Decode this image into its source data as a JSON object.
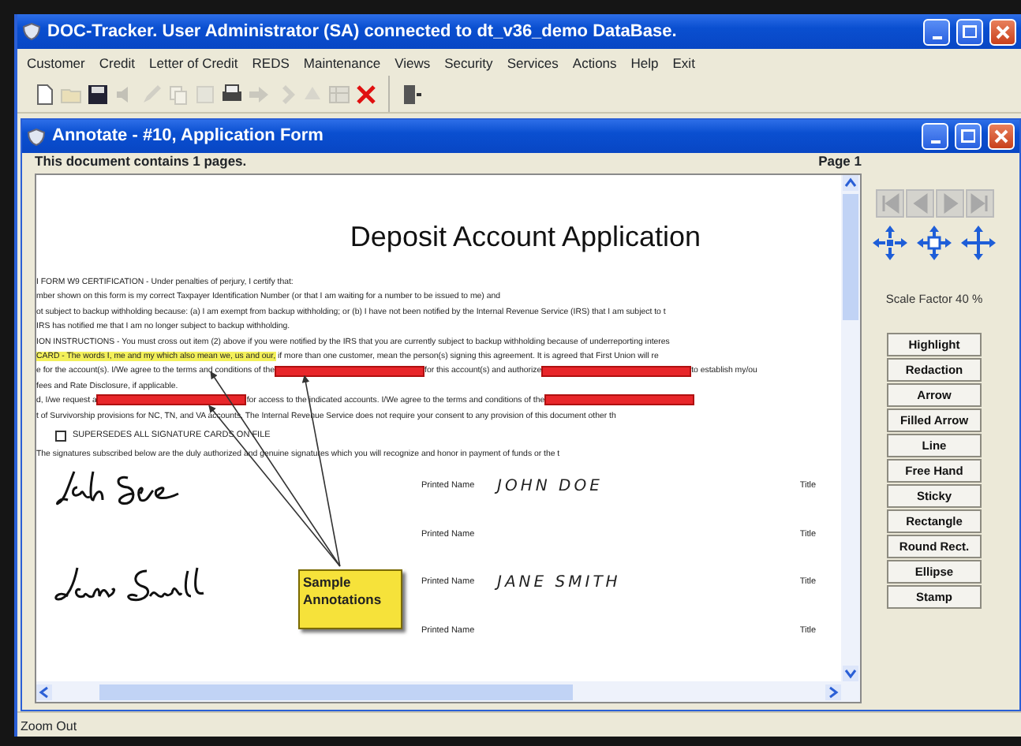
{
  "window": {
    "title": "DOC-Tracker. User Administrator (SA) connected to dt_v36_demo DataBase."
  },
  "menu": [
    "Customer",
    "Credit",
    "Letter of Credit",
    "REDS",
    "Maintenance",
    "Views",
    "Security",
    "Services",
    "Actions",
    "Help",
    "Exit"
  ],
  "toolbar": [
    {
      "disabled": false
    },
    {
      "disabled": true
    },
    {
      "disabled": false
    },
    {
      "disabled": true
    },
    {
      "disabled": true
    },
    {
      "disabled": true
    },
    {
      "disabled": true
    },
    {
      "disabled": false
    },
    {
      "disabled": true
    },
    {
      "disabled": true
    },
    {
      "disabled": true
    },
    {
      "disabled": true
    },
    {
      "disabled": false
    },
    {
      "disabled": false
    }
  ],
  "child_window": {
    "title": "Annotate - #10, Application Form",
    "info": "This document contains 1 pages.",
    "page": "Page 1"
  },
  "document": {
    "title": "Deposit Account Application",
    "lines": [
      [
        {
          "kind": "text",
          "text": "I FORM W9 CERTIFICATION - Under penalties of perjury, I certify that:"
        }
      ],
      [
        {
          "kind": "text",
          "text": "mber shown on this form is my correct Taxpayer Identification Number (or that I am waiting for a number to be issued to me) and"
        }
      ],
      [
        {
          "kind": "text",
          "text": "ot subject to backup withholding because: (a) I am exempt from backup withholding; or (b) I have not been notified by the Internal Revenue Service (IRS) that I am subject to t"
        }
      ],
      [
        {
          "kind": "text",
          "text": "IRS has notified me that I am no longer subject to backup withholding."
        }
      ],
      [
        {
          "kind": "text",
          "text": "ION INSTRUCTIONS - You must cross out item (2) above if you were notified by the IRS that you are currently subject to backup withholding because of underreporting interes"
        }
      ],
      [
        {
          "kind": "highlight",
          "text": "CARD - The words I, me and my which also mean we, us and our,"
        },
        {
          "kind": "text",
          "text": " if more than one customer, mean the person(s) signing this agreement.  It is agreed that First Union will re"
        }
      ],
      [
        {
          "kind": "text",
          "text": "e for the account(s).  I/We agree to the terms and conditions of the"
        },
        {
          "kind": "redaction"
        },
        {
          "kind": "text",
          "text": "for this account(s) and authorize"
        },
        {
          "kind": "redaction"
        },
        {
          "kind": "text",
          "text": "to establish my/ou"
        }
      ],
      [
        {
          "kind": "text",
          "text": "fees and Rate Disclosure, if applicable."
        }
      ],
      [
        {
          "kind": "text",
          "text": "d, I/we request a"
        },
        {
          "kind": "redaction"
        },
        {
          "kind": "text",
          "text": "for access to the indicated accounts. I/We agree to the terms and conditions of the"
        },
        {
          "kind": "redaction"
        }
      ],
      [
        {
          "kind": "text",
          "text": "t of Survivorship provisions for NC, TN, and VA accounts.  The Internal Revenue Service does not require your consent to any provision of this document other th"
        }
      ]
    ],
    "checkbox": {
      "label": "SUPERSEDES ALL SIGNATURE CARDS ON FILE",
      "checked": false
    },
    "statement": "The signatures subscribed below are the duly authorized and genuine signatures which you will recognize and honor in payment of funds or the t",
    "signatures": [
      {
        "signed": true,
        "label": "Printed Name",
        "name": "JOHN DOE",
        "title_label": "Title"
      },
      {
        "signed": false,
        "label": "Printed Name",
        "title_label": "Title"
      },
      {
        "signed": true,
        "label": "Printed Name",
        "name": "JANE SMITH",
        "title_label": "Title"
      },
      {
        "signed": false,
        "label": "Printed Name",
        "title_label": "Title"
      }
    ],
    "sticky_note": "Sample Annotations"
  },
  "panel": {
    "nav_buttons": [
      {
        "disabled": true
      },
      {
        "disabled": true
      },
      {
        "disabled": true
      },
      {
        "disabled": true
      }
    ],
    "scale": "Scale Factor 40 %",
    "tools": [
      "Highlight",
      "Redaction",
      "Arrow",
      "Filled Arrow",
      "Line",
      "Free Hand",
      "Sticky",
      "Rectangle",
      "Round Rect.",
      "Ellipse",
      "Stamp"
    ]
  },
  "status_bar": "Zoom Out"
}
